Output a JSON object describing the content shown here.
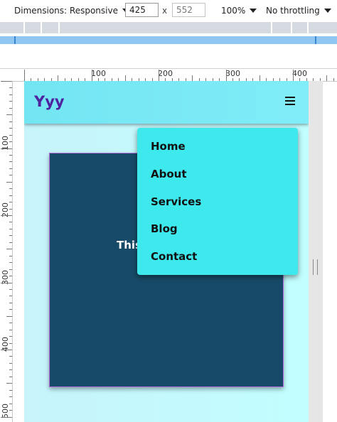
{
  "devtools": {
    "dimensions_label": "Dimensions: Responsive",
    "width_value": "425",
    "height_placeholder": "552",
    "times_sign": "x",
    "zoom_label": "100%",
    "throttle_label": "No throttling"
  },
  "ruler": {
    "top_labels": [
      "100",
      "200",
      "300",
      "400"
    ],
    "left_labels": [
      "100",
      "200",
      "300",
      "400",
      "500"
    ]
  },
  "page": {
    "brand": "Yyy",
    "menu_icon": "hamburger-icon",
    "nav_items": [
      "Home",
      "About",
      "Services",
      "Blog",
      "Contact"
    ],
    "hero_text": "This"
  },
  "colors": {
    "brand_text": "#4f23a0",
    "header_bg": "#73e5f2",
    "dropdown_bg": "#3ee9ee",
    "card_bg": "#174a68",
    "viewport_bg": "#c2feff"
  }
}
